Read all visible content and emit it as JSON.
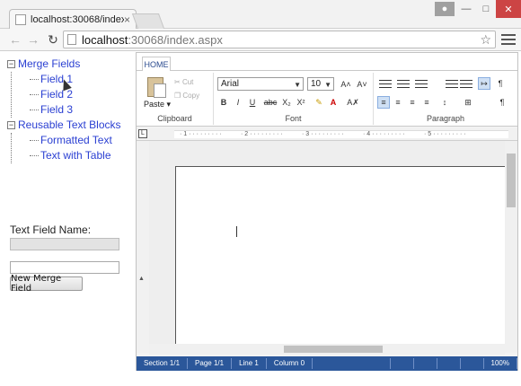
{
  "browser": {
    "tab_title": "localhost:30068/index.aspx",
    "tab_close": "×",
    "url_host": "localhost",
    "url_rest": ":30068/index.aspx"
  },
  "tree": {
    "groups": [
      {
        "label": "Merge Fields",
        "children": [
          "Field 1",
          "Field 2",
          "Field 3"
        ]
      },
      {
        "label": "Reusable Text Blocks",
        "children": [
          "Formatted Text",
          "Text with Table"
        ]
      }
    ]
  },
  "form": {
    "text_field_label": "Text Field Name:",
    "new_button_label": "New Merge Field"
  },
  "ribbon": {
    "tab_home": "HOME",
    "clipboard": {
      "title": "Clipboard",
      "paste": "Paste ▾",
      "cut": "Cut",
      "copy": "Copy"
    },
    "font": {
      "title": "Font",
      "family": "Arial",
      "size": "10"
    },
    "paragraph": {
      "title": "Paragraph"
    }
  },
  "ruler": {
    "marks": [
      "1",
      "2",
      "3",
      "4",
      "5"
    ]
  },
  "status": {
    "section": "Section 1/1",
    "page": "Page 1/1",
    "line": "Line 1",
    "column": "Column 0",
    "zoom": "100%"
  },
  "colors": {
    "status_bar": "#2b579a",
    "link": "#2a3fd2",
    "window_close": "#c44444"
  }
}
